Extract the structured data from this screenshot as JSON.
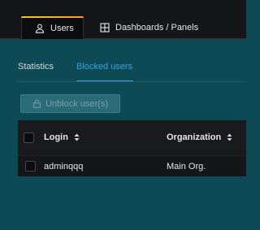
{
  "tabs": [
    {
      "label": "Users",
      "icon": "user-icon",
      "active": true
    },
    {
      "label": "Dashboards / Panels",
      "icon": "grid-icon",
      "active": false
    }
  ],
  "subtabs": [
    {
      "label": "Statistics",
      "active": false
    },
    {
      "label": "Blocked users",
      "active": true
    }
  ],
  "actions": {
    "unblock_label": "Unblock user(s)",
    "unblock_icon": "lock-icon",
    "unblock_disabled": true
  },
  "table": {
    "columns": [
      {
        "label": "Login",
        "sortable": true
      },
      {
        "label": "Organization",
        "sortable": true
      }
    ],
    "rows": [
      {
        "login": "adminqqq",
        "organization": "Main Org."
      }
    ]
  },
  "colors": {
    "accent": "#33a2e5",
    "background": "#0d4a55",
    "tab_gradient": [
      "#f2cc0c",
      "#ff9830"
    ]
  }
}
